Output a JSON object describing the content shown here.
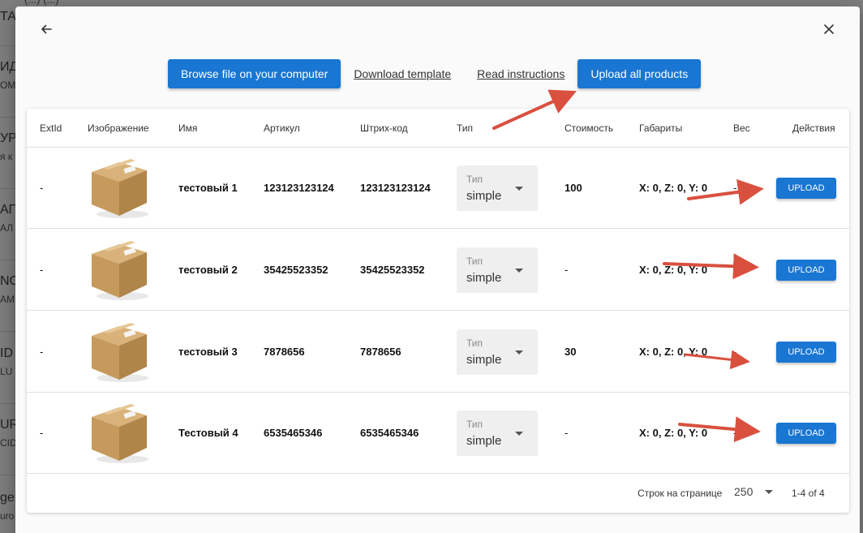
{
  "background": {
    "top_text": "(...) (...)",
    "rows": [
      {
        "title": "ТАI",
        "sub": ""
      },
      {
        "title": "ИД",
        "sub": "ОМ"
      },
      {
        "title": "УР",
        "sub": "я к"
      },
      {
        "title": "АП",
        "sub": "АЛ"
      },
      {
        "title": "NO",
        "sub": "АМ"
      },
      {
        "title": "ID",
        "sub": "LU"
      },
      {
        "title": "UR",
        "sub": "CID"
      },
      {
        "title": "ger",
        "sub": "uro"
      }
    ]
  },
  "dialog": {
    "back_icon": "arrow-left-icon",
    "close_icon": "close-icon",
    "toolbar": {
      "browse_label": "Browse file on your computer",
      "download_label": "Download template",
      "instructions_label": "Read instructions",
      "upload_all_label": "Upload all products"
    },
    "table": {
      "headers": [
        "ExtId",
        "Изображение",
        "Имя",
        "Артикул",
        "Штрих-код",
        "Тип",
        "Стоимость",
        "Габариты",
        "Вес",
        "Действия"
      ],
      "rows": [
        {
          "extid": "-",
          "image": "cardboard-box",
          "name": "тестовый 1",
          "sku": "123123123124",
          "barcode": "123123123124",
          "type_label": "Тип",
          "type_value": "simple",
          "price": "100",
          "dims": "X: 0, Z: 0, Y: 0",
          "weight": "-",
          "action": "UPLOAD"
        },
        {
          "extid": "-",
          "image": "cardboard-box",
          "name": "тестовый 2",
          "sku": "35425523352",
          "barcode": "35425523352",
          "type_label": "Тип",
          "type_value": "simple",
          "price": "-",
          "dims": "X: 0, Z: 0, Y: 0",
          "weight": "-",
          "action": "UPLOAD"
        },
        {
          "extid": "-",
          "image": "cardboard-box",
          "name": "тестовый 3",
          "sku": "7878656",
          "barcode": "7878656",
          "type_label": "Тип",
          "type_value": "simple",
          "price": "30",
          "dims": "X: 0, Z: 0, Y: 0",
          "weight": "-",
          "action": "UPLOAD"
        },
        {
          "extid": "-",
          "image": "cardboard-box",
          "name": "Тестовый 4",
          "sku": "6535465346",
          "barcode": "6535465346",
          "type_label": "Тип",
          "type_value": "simple",
          "price": "-",
          "dims": "X: 0, Z: 0, Y: 0",
          "weight": "-",
          "action": "UPLOAD"
        }
      ],
      "footer": {
        "rows_per_page_label": "Строк на странице",
        "rows_per_page_value": "250",
        "range": "1-4 of 4"
      }
    }
  },
  "colors": {
    "primary": "#1976d2",
    "annotation_arrow": "#d9503f",
    "overlay": "#7e7e7e"
  }
}
